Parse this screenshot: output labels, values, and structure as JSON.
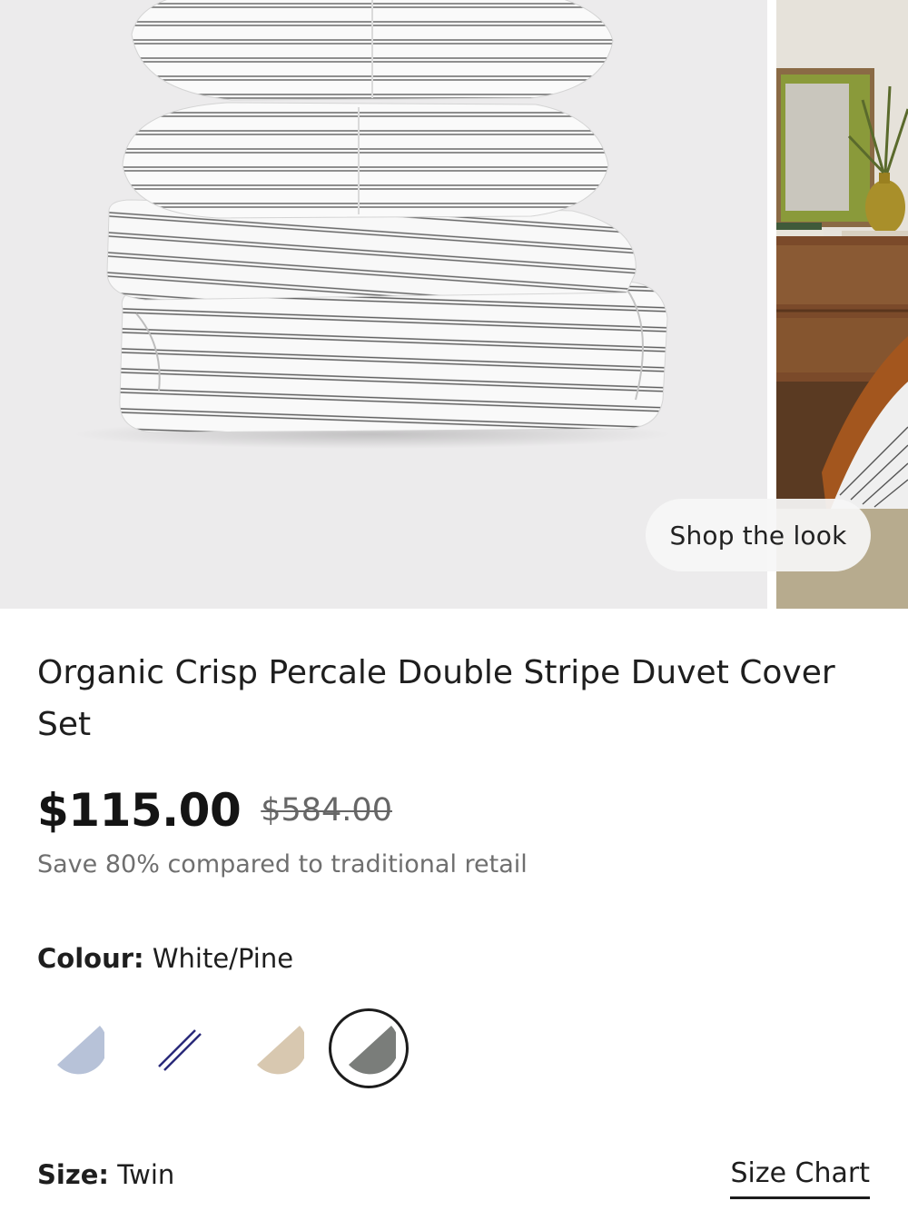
{
  "gallery": {
    "images": [
      {
        "name": "Stack of striped pillows and folded duvet cover"
      },
      {
        "name": "Bedroom lifestyle scene"
      }
    ],
    "shop_look_label": "Shop the look"
  },
  "product": {
    "title": "Organic Crisp Percale Double Stripe Duvet Cover Set",
    "price": "$115.00",
    "compare_price": "$584.00",
    "savings_text": "Save 80% compared to traditional retail"
  },
  "colour": {
    "label": "Colour:",
    "selected": "White/Pine",
    "swatches": [
      {
        "name": "light-blue",
        "color": "#b7c2d8",
        "style": "half"
      },
      {
        "name": "navy-stripe",
        "color": "#2a2a7a",
        "style": "stripe"
      },
      {
        "name": "sand",
        "color": "#d8c8b0",
        "style": "half"
      },
      {
        "name": "white-pine",
        "color": "#7a7d7a",
        "style": "half",
        "selected": true
      }
    ]
  },
  "size": {
    "label": "Size:",
    "selected": "Twin",
    "chart_link": "Size Chart"
  }
}
